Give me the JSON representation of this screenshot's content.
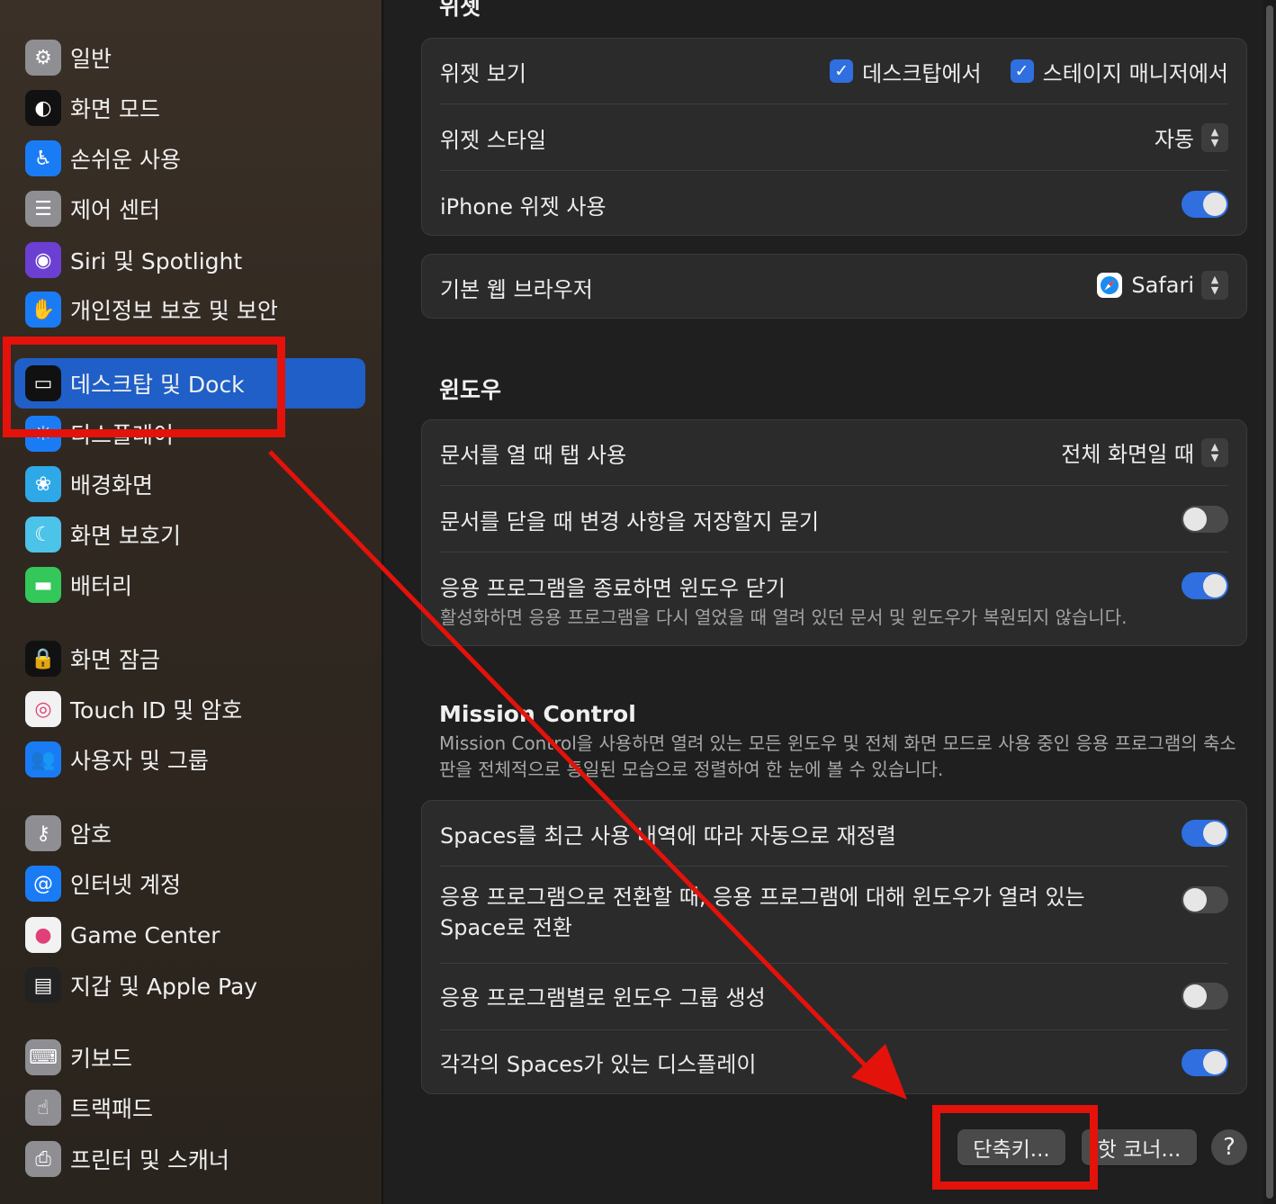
{
  "sidebar": {
    "items": [
      {
        "label": "일반",
        "icon": "gear-icon",
        "color": "#8e8e93",
        "glyph": "⚙"
      },
      {
        "label": "화면 모드",
        "icon": "appearance-icon",
        "color": "#111111",
        "glyph": "◐"
      },
      {
        "label": "손쉬운 사용",
        "icon": "accessibility-icon",
        "color": "#1a7cf5",
        "glyph": "♿"
      },
      {
        "label": "제어 센터",
        "icon": "control-center-icon",
        "color": "#8e8e93",
        "glyph": "☰"
      },
      {
        "label": "Siri 및 Spotlight",
        "icon": "siri-icon",
        "color": "#6b3fd1",
        "glyph": "◉"
      },
      {
        "label": "개인정보 보호 및 보안",
        "icon": "hand-icon",
        "color": "#1a7cf5",
        "glyph": "✋"
      },
      {
        "label": "데스크탑 및 Dock",
        "icon": "dock-icon",
        "color": "#111111",
        "glyph": "▭",
        "active": true
      },
      {
        "label": "디스플레이",
        "icon": "display-icon",
        "color": "#1a7cf5",
        "glyph": "☀"
      },
      {
        "label": "배경화면",
        "icon": "wallpaper-icon",
        "color": "#2fa8e8",
        "glyph": "❀"
      },
      {
        "label": "화면 보호기",
        "icon": "screensaver-icon",
        "color": "#4cc3e8",
        "glyph": "☾"
      },
      {
        "label": "배터리",
        "icon": "battery-icon",
        "color": "#34c759",
        "glyph": "▬"
      },
      {
        "label": "화면 잠금",
        "icon": "lock-icon",
        "color": "#111111",
        "glyph": "🔒"
      },
      {
        "label": "Touch ID 및 암호",
        "icon": "fingerprint-icon",
        "color": "#f2f2f2",
        "glyph": "◎"
      },
      {
        "label": "사용자 및 그룹",
        "icon": "users-icon",
        "color": "#1a7cf5",
        "glyph": "👥"
      },
      {
        "label": "암호",
        "icon": "key-icon",
        "color": "#8e8e93",
        "glyph": "⚷"
      },
      {
        "label": "인터넷 계정",
        "icon": "at-icon",
        "color": "#1a7cf5",
        "glyph": "@"
      },
      {
        "label": "Game Center",
        "icon": "game-center-icon",
        "color": "#f2f2f2",
        "glyph": "●"
      },
      {
        "label": "지갑 및 Apple Pay",
        "icon": "wallet-icon",
        "color": "#222222",
        "glyph": "▤"
      },
      {
        "label": "키보드",
        "icon": "keyboard-icon",
        "color": "#8e8e93",
        "glyph": "⌨"
      },
      {
        "label": "트랙패드",
        "icon": "trackpad-icon",
        "color": "#8e8e93",
        "glyph": "☝"
      },
      {
        "label": "프린터 및 스캐너",
        "icon": "printer-icon",
        "color": "#8e8e93",
        "glyph": "⎙"
      }
    ]
  },
  "widgets": {
    "section_title": "위젯",
    "show_widgets_label": "위젯 보기",
    "on_desktop_label": "데스크탑에서",
    "on_desktop_checked": true,
    "in_stage_manager_label": "스테이지 매니저에서",
    "in_stage_manager_checked": true,
    "widget_style_label": "위젯 스타일",
    "widget_style_value": "자동",
    "iphone_widgets_label": "iPhone 위젯 사용",
    "iphone_widgets_on": true
  },
  "browser": {
    "label": "기본 웹 브라우저",
    "value": "Safari",
    "icon": "safari-icon"
  },
  "windows": {
    "section_title": "윈도우",
    "prefer_tabs_label": "문서를 열 때 탭 사용",
    "prefer_tabs_value": "전체 화면일 때",
    "ask_keep_changes_label": "문서를 닫을 때 변경 사항을 저장할지 묻기",
    "ask_keep_changes_on": false,
    "close_windows_label": "응용 프로그램을 종료하면 윈도우 닫기",
    "close_windows_sub": "활성화하면 응용 프로그램을 다시 열었을 때 열려 있던 문서 및 윈도우가 복원되지 않습니다.",
    "close_windows_on": true
  },
  "mission_control": {
    "section_title": "Mission Control",
    "description": "Mission Control을 사용하면 열려 있는 모든 윈도우 및 전체 화면 모드로 사용 중인 응용 프로그램의 축소판을 전체적으로 통일된 모습으로 정렬하여 한 눈에 볼 수 있습니다.",
    "auto_rearrange_label": "Spaces를 최근 사용 내역에 따라 자동으로 재정렬",
    "auto_rearrange_on": true,
    "switch_space_label": "응용 프로그램으로 전환할 때, 응용 프로그램에 대해 윈도우가 열려 있는 Space로 전환",
    "switch_space_on": false,
    "group_windows_label": "응용 프로그램별로 윈도우 그룹 생성",
    "group_windows_on": false,
    "separate_spaces_label": "각각의 Spaces가 있는 디스플레이",
    "separate_spaces_on": true
  },
  "footer": {
    "shortcuts_button": "단축키...",
    "hot_corners_button": "핫 코너...",
    "help_button": "?"
  },
  "colors": {
    "accent": "#2f6fe0",
    "annotation_red": "#e3120b",
    "sidebar_active": "#1f5fc7"
  }
}
